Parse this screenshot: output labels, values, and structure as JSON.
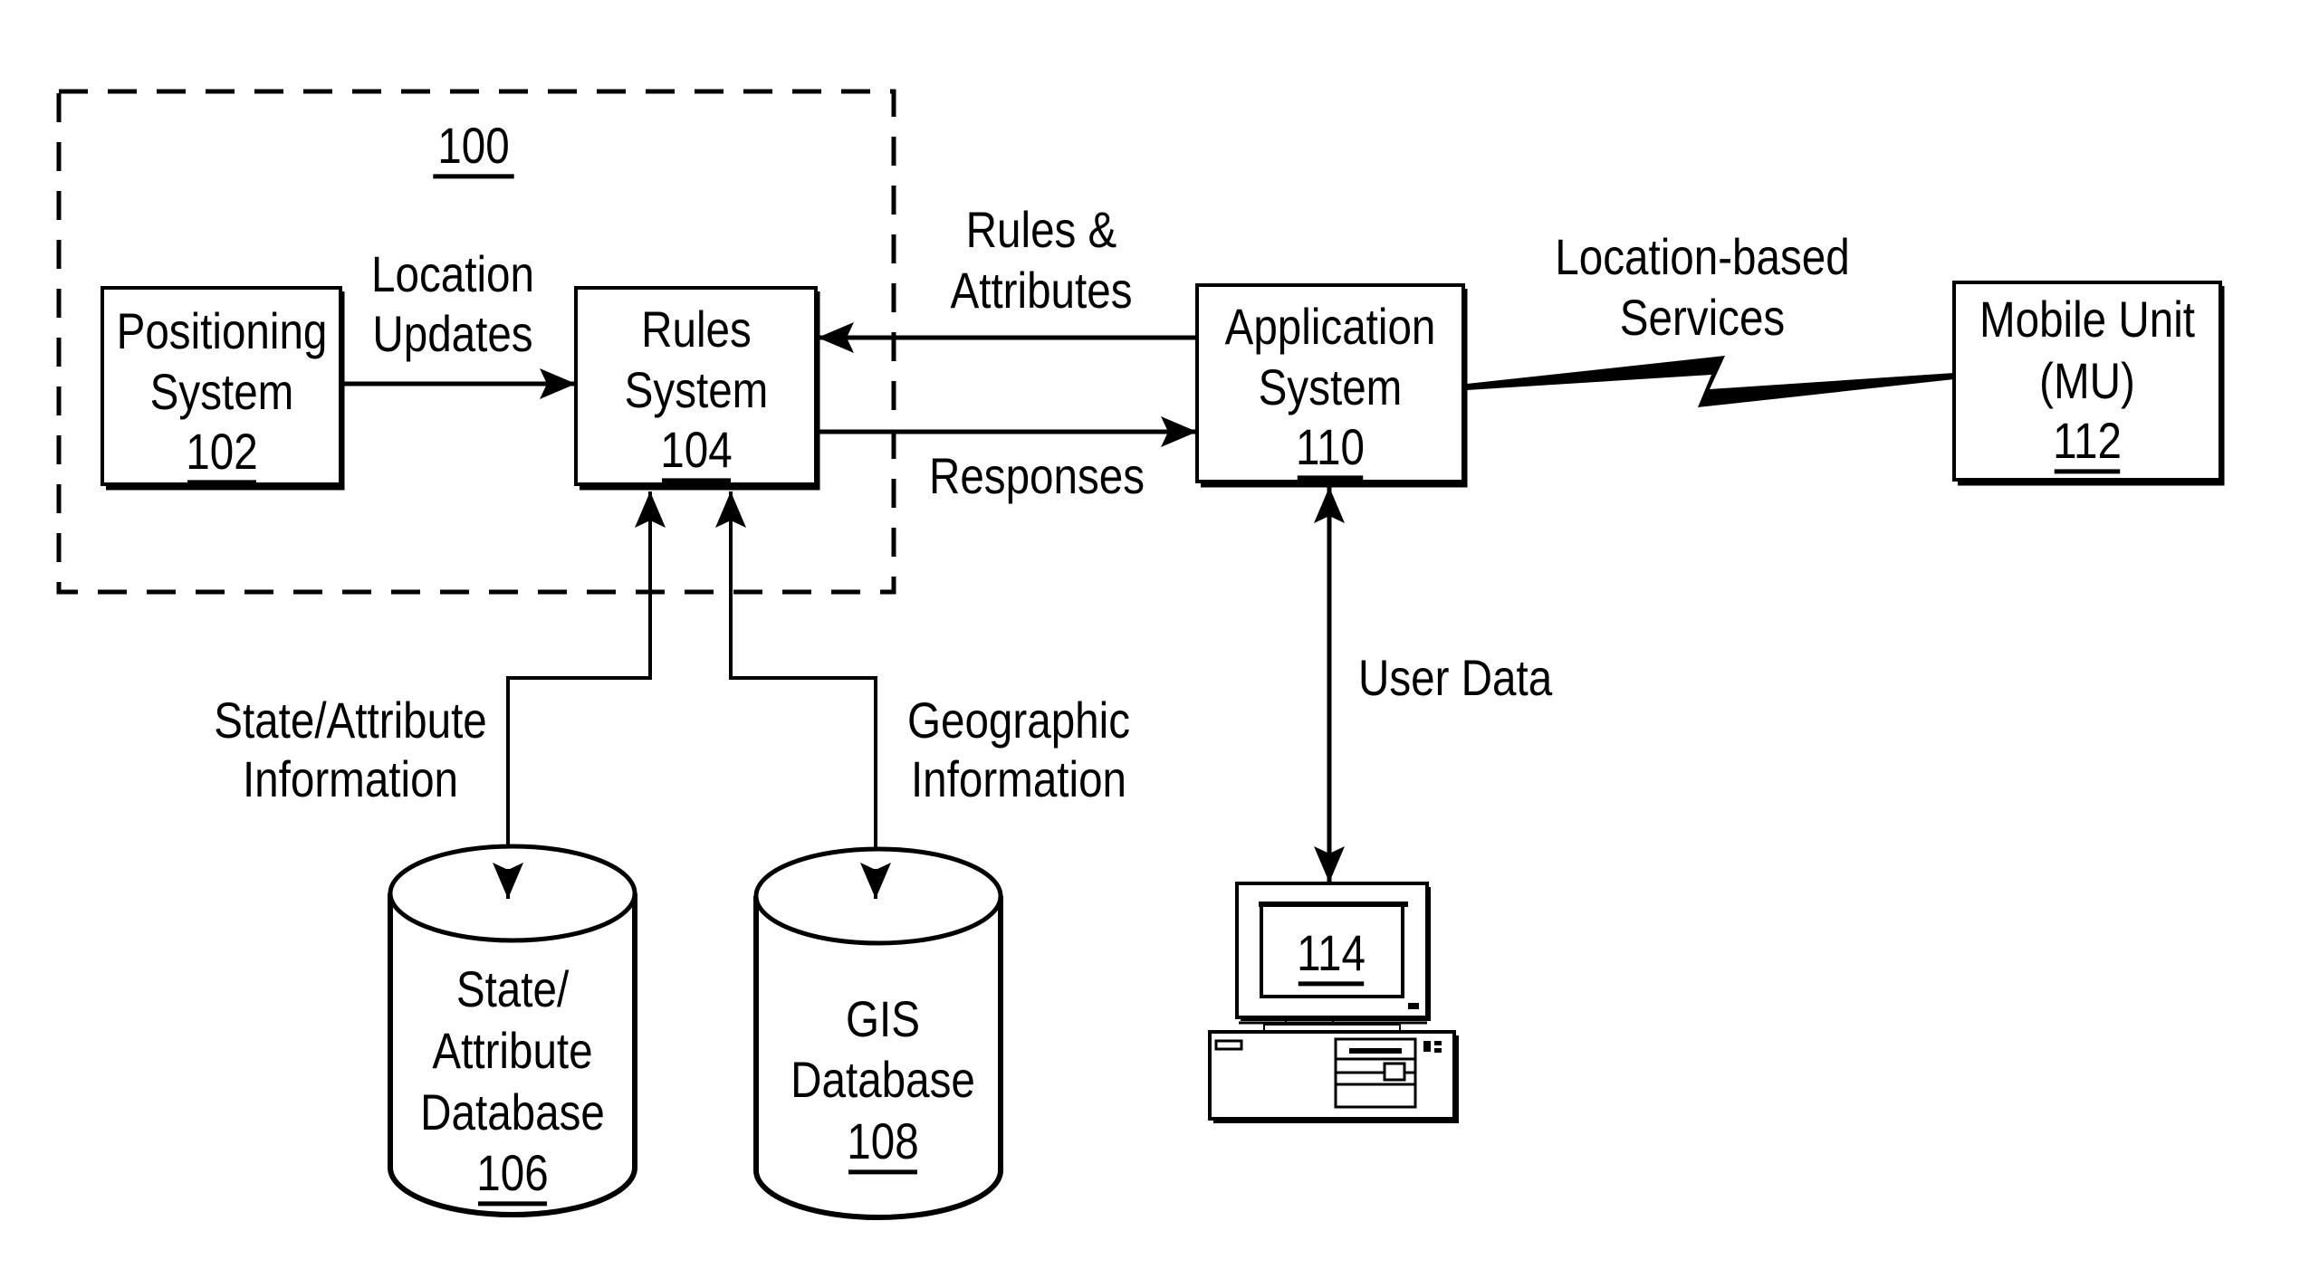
{
  "figure": {
    "system_group": {
      "ref": "100"
    },
    "nodes": {
      "positioning": {
        "lines": [
          "Positioning",
          "System"
        ],
        "ref": "102"
      },
      "rules": {
        "lines": [
          "Rules",
          "System"
        ],
        "ref": "104"
      },
      "state_db": {
        "lines": [
          "State/",
          "Attribute",
          "Database"
        ],
        "ref": "106"
      },
      "gis_db": {
        "lines": [
          "GIS",
          "Database"
        ],
        "ref": "108"
      },
      "application": {
        "lines": [
          "Application",
          "System"
        ],
        "ref": "110"
      },
      "mobile": {
        "lines": [
          "Mobile Unit",
          "(MU)"
        ],
        "ref": "112"
      },
      "computer": {
        "ref": "114"
      }
    },
    "edges": {
      "location_updates": {
        "lines": [
          "Location",
          "Updates"
        ]
      },
      "rules_attributes": {
        "lines": [
          "Rules &",
          "Attributes"
        ]
      },
      "responses": {
        "lines": [
          "Responses"
        ]
      },
      "location_services": {
        "lines": [
          "Location-based",
          "Services"
        ]
      },
      "state_info": {
        "lines": [
          "State/Attribute",
          "Information"
        ]
      },
      "geo_info": {
        "lines": [
          "Geographic",
          "Information"
        ]
      },
      "user_data": {
        "lines": [
          "User Data"
        ]
      }
    }
  }
}
